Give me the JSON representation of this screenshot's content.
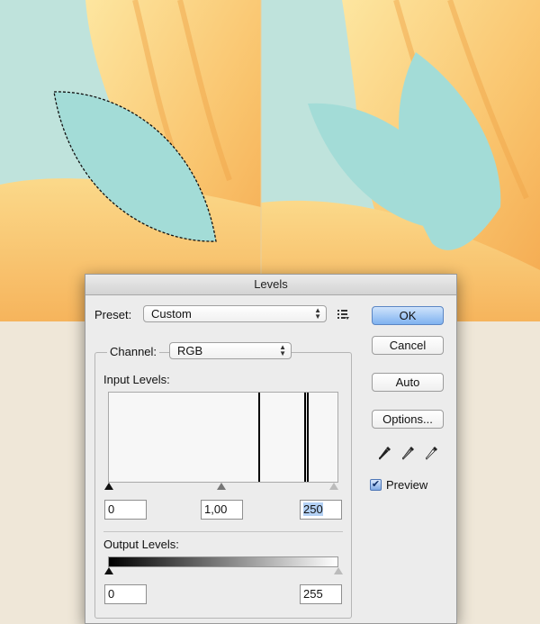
{
  "dialog": {
    "title": "Levels",
    "preset_label": "Preset:",
    "preset_value": "Custom",
    "channel_label": "Channel:",
    "channel_value": "RGB",
    "input_levels_label": "Input Levels:",
    "output_levels_label": "Output Levels:",
    "input_black": "0",
    "input_gamma": "1,00",
    "input_white": "250",
    "output_black": "0",
    "output_white": "255",
    "ok_label": "OK",
    "cancel_label": "Cancel",
    "auto_label": "Auto",
    "options_label": "Options...",
    "preview_label": "Preview",
    "preview_checked": true
  },
  "colors": {
    "canvas_bg": "#bfe3dc",
    "petal": "#f8c067",
    "leaf": "#a3dcd7",
    "primary_button": "#7fb2f0"
  },
  "icons": [
    "preset-menu-icon",
    "black-eyedropper-icon",
    "gray-eyedropper-icon",
    "white-eyedropper-icon"
  ]
}
